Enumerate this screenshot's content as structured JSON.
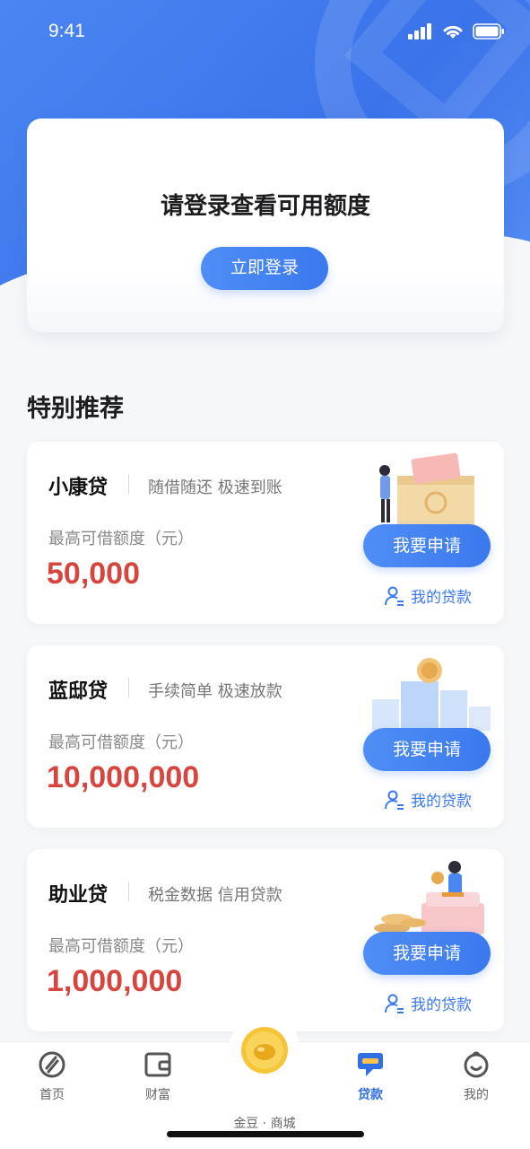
{
  "status_bar": {
    "time": "9:41"
  },
  "login_card": {
    "title": "请登录查看可用额度",
    "button_label": "立即登录"
  },
  "section_title": "特别推荐",
  "loans": [
    {
      "name": "小康贷",
      "desc": "随借随还 极速到账",
      "amount_label": "最高可借额度（元）",
      "amount": "50,000",
      "apply_label": "我要申请",
      "my_loan_label": "我的贷款"
    },
    {
      "name": "蓝邸贷",
      "desc": "手续简单 极速放款",
      "amount_label": "最高可借额度（元）",
      "amount": "10,000,000",
      "apply_label": "我要申请",
      "my_loan_label": "我的贷款"
    },
    {
      "name": "助业贷",
      "desc": "税金数据 信用贷款",
      "amount_label": "最高可借额度（元）",
      "amount": "1,000,000",
      "apply_label": "我要申请",
      "my_loan_label": "我的贷款"
    }
  ],
  "tabbar": {
    "items": [
      {
        "label": "首页",
        "icon": "home-logo-icon"
      },
      {
        "label": "财富",
        "icon": "wallet-icon"
      },
      {
        "label": "金豆 · 商城",
        "icon": "gold-coin-icon"
      },
      {
        "label": "贷款",
        "icon": "loan-chat-icon"
      },
      {
        "label": "我的",
        "icon": "profile-face-icon"
      }
    ],
    "active": "贷款"
  },
  "colors": {
    "primary": "#3a79ee",
    "amount": "#d6453e",
    "hero": "#4a86f2"
  }
}
